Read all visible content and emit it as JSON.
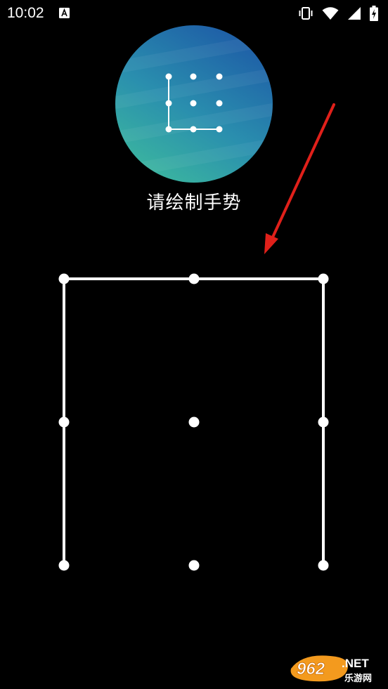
{
  "status_bar": {
    "time": "10:02",
    "icons": [
      "text-a-notification-icon",
      "vibrate-icon",
      "wifi-icon",
      "cell-signal-icon",
      "battery-charging-icon"
    ]
  },
  "lock_setup": {
    "prompt": "请绘制手势",
    "pattern_grid": {
      "rows": 3,
      "cols": 3,
      "drawn_sequence": [
        7,
        4,
        1,
        2,
        3,
        6,
        9
      ]
    },
    "preview_pattern": {
      "drawn_sequence": [
        1,
        4,
        7,
        8,
        9
      ]
    }
  },
  "colors": {
    "background": "#000000",
    "pattern_line": "#ffffff",
    "arrow": "#e0201a",
    "avatar_gradient_top": "#1f5ea8",
    "avatar_gradient_bottom": "#3ab5a0"
  },
  "watermark": {
    "brand_number": "962",
    "brand_suffix": ".NET",
    "brand_cn": "乐游网"
  }
}
